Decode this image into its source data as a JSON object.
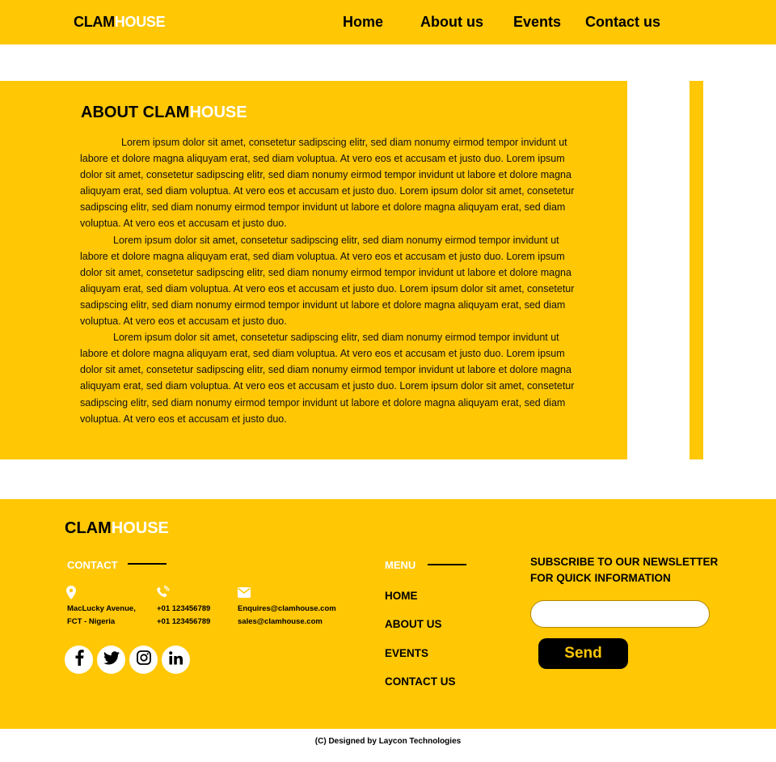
{
  "brand": {
    "part1": "CLAM",
    "part2": "HOUSE"
  },
  "nav": {
    "home": "Home",
    "about": "About us",
    "events": "Events",
    "contact": "Contact us"
  },
  "about": {
    "title_part1": "ABOUT CLAM",
    "title_part2": "HOUSE",
    "paragraphs": [
      "Lorem ipsum dolor sit amet, consetetur sadipscing elitr, sed diam nonumy eirmod tempor invidunt ut labore et dolore magna aliquyam erat, sed diam voluptua. At vero eos et accusam et justo duo. Lorem ipsum dolor sit amet, consetetur sadipscing elitr, sed diam nonumy eirmod tempor invidunt ut labore et dolore magna aliquyam erat, sed diam voluptua. At vero eos et accusam et justo duo. Lorem ipsum dolor sit amet, consetetur sadipscing elitr, sed diam nonumy eirmod tempor invidunt ut labore et dolore magna aliquyam erat, sed diam voluptua. At vero eos et accusam et justo duo.",
      "Lorem ipsum dolor sit amet, consetetur sadipscing elitr, sed diam nonumy eirmod tempor invidunt ut labore et dolore magna aliquyam erat, sed diam voluptua. At vero eos et accusam et justo duo. Lorem ipsum dolor sit amet, consetetur sadipscing elitr, sed diam nonumy eirmod tempor invidunt ut labore et dolore magna aliquyam erat, sed diam voluptua. At vero eos et accusam et justo duo. Lorem ipsum dolor sit amet, consetetur sadipscing elitr, sed diam nonumy eirmod tempor invidunt ut labore et dolore magna aliquyam erat, sed diam voluptua. At vero eos et accusam et justo duo.",
      "Lorem ipsum dolor sit amet, consetetur sadipscing elitr, sed diam nonumy eirmod tempor invidunt ut labore et dolore magna aliquyam erat, sed diam voluptua. At vero eos et accusam et justo duo. Lorem ipsum dolor sit amet, consetetur sadipscing elitr, sed diam nonumy eirmod tempor invidunt ut labore et dolore magna aliquyam erat, sed diam voluptua. At vero eos et accusam et justo duo. Lorem ipsum dolor sit amet, consetetur sadipscing elitr, sed diam nonumy eirmod tempor invidunt ut labore et dolore magna aliquyam erat, sed diam voluptua. At vero eos et accusam et justo duo."
    ]
  },
  "footer": {
    "contact_heading": "CONTACT",
    "address": [
      "MacLucky Avenue,",
      "FCT - Nigeria"
    ],
    "phones": [
      "+01 123456789",
      "+01 123456789"
    ],
    "emails": [
      "Enquires@clamhouse.com",
      "sales@clamhouse.com"
    ],
    "icons": {
      "location": "location-pin-icon",
      "phone": "phone-icon",
      "email": "mail-icon",
      "social": [
        "facebook-icon",
        "twitter-icon",
        "instagram-icon",
        "linkedin-icon"
      ]
    },
    "menu_heading": "MENU",
    "menu": [
      "HOME",
      "ABOUT US",
      "EVENTS",
      "CONTACT US"
    ],
    "newsletter_heading": "SUBSCRIBE TO OUR NEWSLETTER FOR QUICK INFORMATION",
    "email_placeholder": "",
    "send_label": "Send",
    "credit": "(C) Designed by Laycon Technologies"
  },
  "colors": {
    "accent": "#FFC704",
    "text": "#000000",
    "white": "#FFFFFF"
  }
}
